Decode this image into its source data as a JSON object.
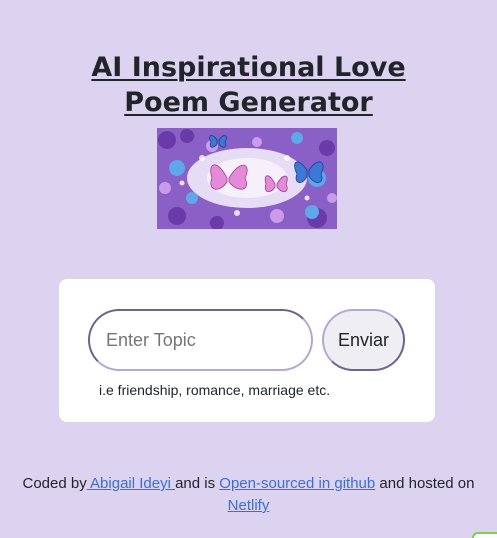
{
  "header": {
    "title": "AI Inspirational Love Poem Generator"
  },
  "hero": {
    "alt": "butterflies and flowers"
  },
  "form": {
    "placeholder": "Enter Topic",
    "submit_label": "Enviar",
    "hint": "i.e friendship, romance, marriage etc."
  },
  "footer": {
    "coded_by": "Coded by",
    "author_link": " Abigail Ideyi ",
    "and_is": "and is",
    "github_link": "Open-sourced in github",
    "hosted_on": "and hosted on",
    "host_link": "Netlify"
  },
  "colors": {
    "background": "#dcd3f0",
    "card": "#ffffff",
    "link": "#3b6ed8"
  }
}
